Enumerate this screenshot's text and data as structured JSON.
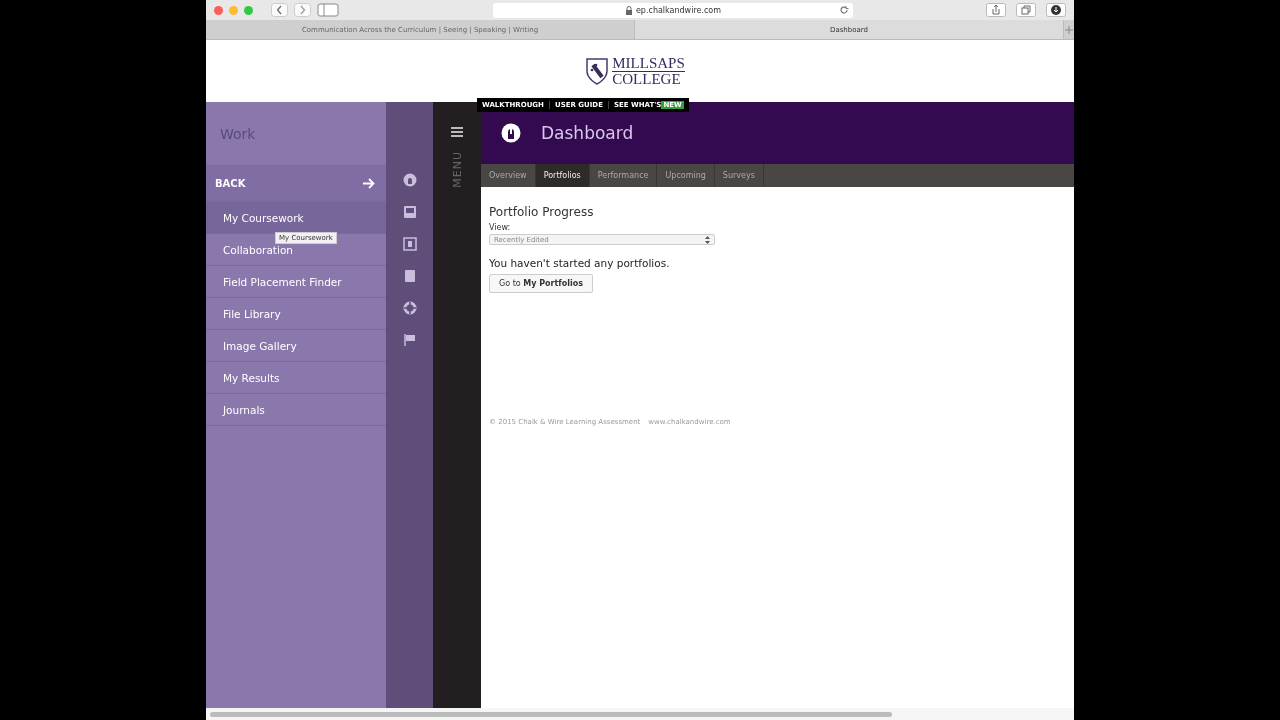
{
  "browser": {
    "url": "ep.chalkandwire.com",
    "tabs": [
      {
        "label": "Communication Across the Curriculum | Seeing | Speaking | Writing",
        "selected": false
      },
      {
        "label": "Dashboard",
        "selected": true
      }
    ]
  },
  "logo": {
    "line1": "MILLSAPS",
    "line2": "COLLEGE"
  },
  "top_links": [
    {
      "label": "WALKTHROUGH"
    },
    {
      "label": "USER GUIDE"
    },
    {
      "label": "SEE WHAT'S",
      "badge": "NEW"
    }
  ],
  "sidebar": {
    "title": "Work",
    "back": "BACK",
    "tooltip": "My Coursework",
    "items": [
      {
        "label": "My Coursework",
        "selected": true
      },
      {
        "label": "Collaboration",
        "selected": false
      },
      {
        "label": "Field Placement Finder",
        "selected": false
      },
      {
        "label": "File Library",
        "selected": false
      },
      {
        "label": "Image Gallery",
        "selected": false
      },
      {
        "label": "My Results",
        "selected": false
      },
      {
        "label": "Journals",
        "selected": false
      }
    ]
  },
  "menu": {
    "label": "MENU"
  },
  "header": {
    "title": "Dashboard"
  },
  "tabs": [
    {
      "label": "Overview",
      "selected": false
    },
    {
      "label": "Portfolios",
      "selected": true
    },
    {
      "label": "Performance",
      "selected": false
    },
    {
      "label": "Upcoming",
      "selected": false
    },
    {
      "label": "Surveys",
      "selected": false
    }
  ],
  "section": {
    "title": "Portfolio Progress",
    "view_label": "View:",
    "select": {
      "value": "Recently Edited"
    },
    "message": "You haven't started any portfolios.",
    "button": "Go to **My Portfolios**"
  },
  "footer": {
    "copyright": "© 2015 Chalk & Wire Learning Assessment",
    "link": "www.chalkandwire.com"
  }
}
